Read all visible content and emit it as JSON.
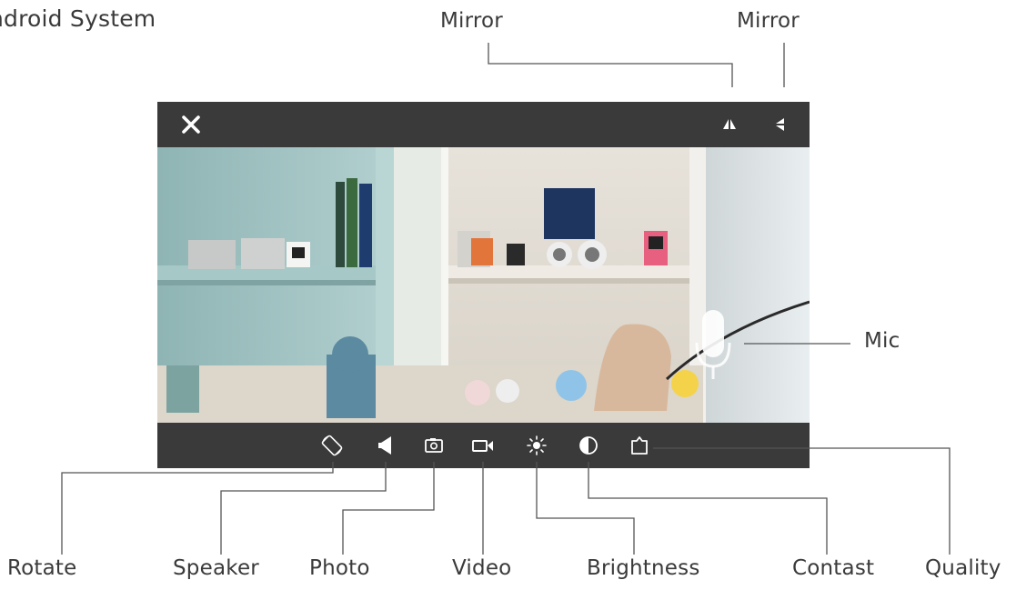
{
  "annotations": {
    "title": "ndroid System",
    "mirror_left": "Mirror",
    "mirror_right": "Mirror",
    "mic": "Mic",
    "rotate": "Rotate",
    "speaker": "Speaker",
    "photo": "Photo",
    "video": "Video",
    "brightness": "Brightness",
    "contast": "Contast",
    "quality": "Quality"
  },
  "viewer": {
    "top_bar_icons": [
      "close-icon",
      "mirror-horizontal-icon",
      "mirror-vertical-icon"
    ],
    "floating_icons": [
      "mic-icon"
    ],
    "bottom_bar_icons": [
      "rotate-icon",
      "speaker-icon",
      "camera-icon",
      "video-icon",
      "brightness-icon",
      "contrast-icon",
      "quality-icon"
    ]
  },
  "colors": {
    "bar_background": "#3a3a3a",
    "icon": "#ffffff",
    "label_text": "#3a3a3a",
    "leader_line": "#555555"
  }
}
